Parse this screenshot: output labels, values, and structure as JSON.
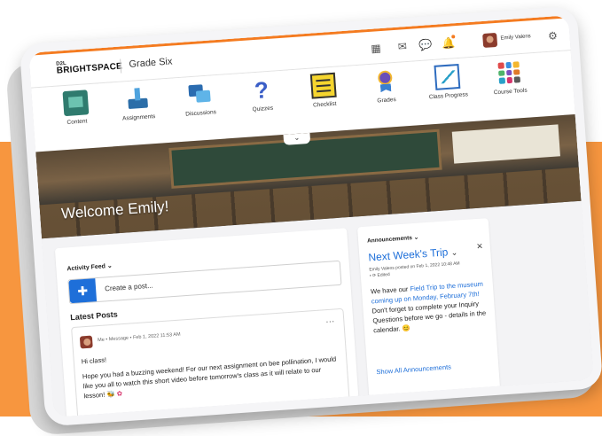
{
  "header": {
    "logo_small": "D2L",
    "logo_main": "BRIGHTSPACE",
    "course_title": "Grade Six",
    "user_name": "Emily Valens"
  },
  "nav": {
    "items": [
      {
        "label": "Content",
        "icon": "content-icon"
      },
      {
        "label": "Assignments",
        "icon": "assignments-icon"
      },
      {
        "label": "Discussions",
        "icon": "discussions-icon"
      },
      {
        "label": "Quizzes",
        "icon": "quizzes-icon"
      },
      {
        "label": "Checklist",
        "icon": "checklist-icon"
      },
      {
        "label": "Grades",
        "icon": "grades-icon"
      },
      {
        "label": "Class Progress",
        "icon": "class-progress-icon"
      },
      {
        "label": "Course Tools",
        "icon": "course-tools-icon"
      }
    ]
  },
  "banner": {
    "welcome": "Welcome Emily!"
  },
  "activity_feed": {
    "label": "Activity Feed",
    "placeholder": "Create a post...",
    "latest_posts_heading": "Latest Posts",
    "post": {
      "meta": "Me • Message • Feb 1, 2022 11:53 AM",
      "greeting": "Hi class!",
      "body": "Hope you had a buzzing weekend! For our next assignment on bee pollination, I would like you all to watch this short video before tomorrow's class as it will relate to our lesson!"
    }
  },
  "announcements": {
    "label": "Announcements",
    "title": "Next Week's Trip",
    "byline": "Emily Valens posted on Feb 1, 2022 10:48 AM",
    "edited": "Edited",
    "body_before": "We have our ",
    "body_link": "Field Trip to the museum coming up on Monday, February 7th!",
    "body_after": " Don't forget to complete your Inquiry Questions before we go - details in the calendar.",
    "show_all": "Show All Announcements"
  },
  "colors": {
    "accent": "#f47b20",
    "link": "#1e6fd9",
    "background_band": "#f7963f"
  }
}
